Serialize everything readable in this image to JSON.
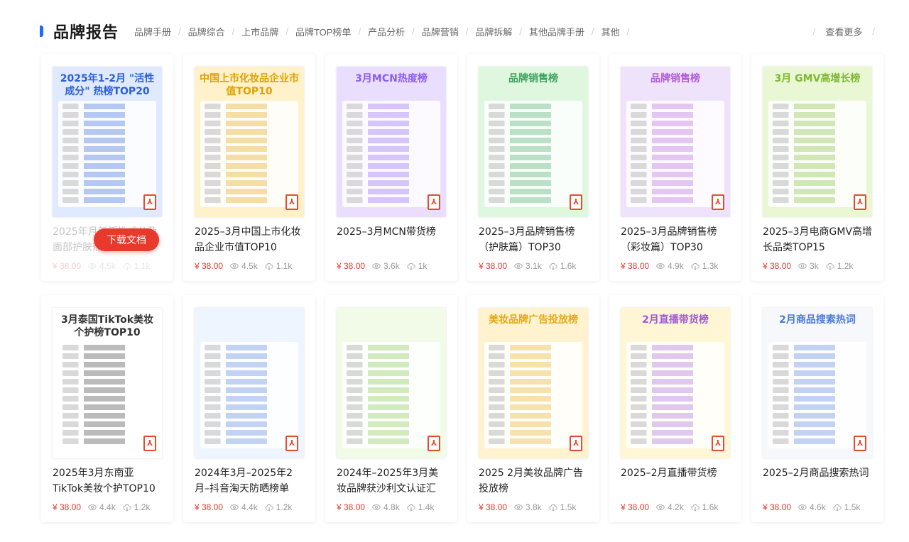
{
  "header": {
    "title": "品牌报告",
    "nav": [
      "品牌手册",
      "品牌综合",
      "上市品牌",
      "品牌TOP榜单",
      "产品分析",
      "品牌营销",
      "品牌拆解",
      "其他品牌手册",
      "其他"
    ],
    "more": "查看更多"
  },
  "download_label": "下载文档",
  "cards": [
    {
      "title": "2025年月新活性成分及面部护肤热榜TOP20",
      "poster": "2025年1-2月 \"活性成分\" 热榜TOP20",
      "bg": "#dfe9ff",
      "accent": "#2b5fd9",
      "price": "¥ 38.00",
      "views": "4.5k",
      "downloads": "1.1k"
    },
    {
      "title": "2025–3月中国上市化妆品企业市值TOP10",
      "poster": "中国上市化妆品企业市值TOP10",
      "bg": "#fff1c9",
      "accent": "#e0a100",
      "price": "¥ 38.00",
      "views": "4.5k",
      "downloads": "1.1k"
    },
    {
      "title": "2025–3月MCN带货榜",
      "poster": "3月MCN热度榜",
      "bg": "#e9defd",
      "accent": "#8b5cf6",
      "price": "¥ 38.00",
      "views": "3.6k",
      "downloads": "1k"
    },
    {
      "title": "2025–3月品牌销售榜（护肤篇）TOP30",
      "poster": "品牌销售榜",
      "bg": "#dff6df",
      "accent": "#3aa35b",
      "price": "¥ 38.00",
      "views": "3.1k",
      "downloads": "1.6k"
    },
    {
      "title": "2025–3月品牌销售榜（彩妆篇）TOP30",
      "poster": "品牌销售榜",
      "bg": "#efe3fb",
      "accent": "#b05bd6",
      "price": "¥ 38.00",
      "views": "4.9k",
      "downloads": "1.3k"
    },
    {
      "title": "2025–3月电商GMV高增长品类TOP15",
      "poster": "3月 GMV高增长榜",
      "bg": "#eaf7d4",
      "accent": "#7cb82f",
      "price": "¥ 38.00",
      "views": "3k",
      "downloads": "1.2k"
    },
    {
      "title": "2025年3月东南亚TikTok美妆个护TOP10",
      "poster": "3月泰国TikTok美妆个护榜TOP10",
      "bg": "#ffffff",
      "accent": "#333333",
      "price": "¥ 38.00",
      "views": "4.4k",
      "downloads": "1.2k"
    },
    {
      "title": "2024年3月–2025年2月–抖音淘天防晒榜单",
      "poster": "",
      "bg": "#eef5ff",
      "accent": "#4a7bd8",
      "price": "¥ 38.00",
      "views": "4.4k",
      "downloads": "1.2k"
    },
    {
      "title": "2024年–2025年3月美妆品牌获沙利文认证汇",
      "poster": "",
      "bg": "#f2fbe8",
      "accent": "#79c043",
      "price": "¥ 38.00",
      "views": "4.8k",
      "downloads": "1.4k"
    },
    {
      "title": "2025 2月美妆品牌广告投放榜",
      "poster": "美妆品牌广告投放榜",
      "bg": "#fff3cf",
      "accent": "#e6a817",
      "price": "¥ 38.00",
      "views": "3.8k",
      "downloads": "1.5k"
    },
    {
      "title": "2025–2月直播带货榜",
      "poster": "2月直播带货榜",
      "bg": "#fff6d6",
      "accent": "#a05ad6",
      "price": "¥ 38.00",
      "views": "4.2k",
      "downloads": "1.6k"
    },
    {
      "title": "2025–2月商品搜索热词",
      "poster": "2月商品搜索热词",
      "bg": "#f6f8fb",
      "accent": "#4a7bd8",
      "price": "¥ 38.00",
      "views": "4.6k",
      "downloads": "1.5k"
    }
  ]
}
